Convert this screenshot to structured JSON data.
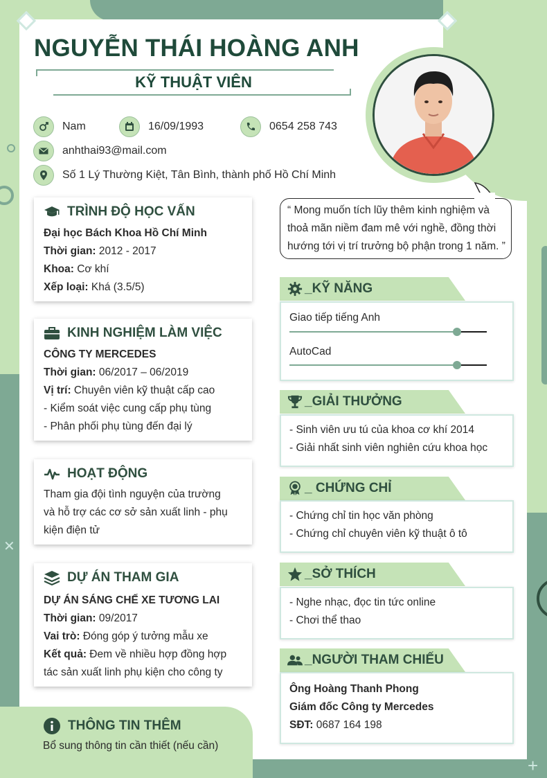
{
  "header": {
    "name": "NGUYỄN THÁI HOÀNG ANH",
    "job_title": "KỸ THUẬT VIÊN"
  },
  "contact": {
    "gender": "Nam",
    "birthday": "16/09/1993",
    "phone": "0654 258 743",
    "email": "anhthai93@mail.com",
    "address": "Số 1 Lý Thường Kiệt, Tân Bình, thành phố Hồ Chí Minh"
  },
  "quote": {
    "lines": [
      "“ Mong muốn tích lũy thêm kinh nghiệm và",
      "thoả mãn niềm đam mê với nghề, đồng thời",
      "hướng tới vị trí trưởng bộ phận trong 1 năm. ”"
    ]
  },
  "education": {
    "title": "TRÌNH ĐỘ HỌC VẤN",
    "school": "Đại học Bách Khoa Hồ Chí Minh",
    "time_label": "Thời gian:",
    "time_value": " 2012 - 2017",
    "faculty_label": "Khoa:",
    "faculty_value": " Cơ khí",
    "rank_label": "Xếp loại:",
    "rank_value": " Khá (3.5/5)"
  },
  "experience": {
    "title": "KINH NGHIỆM LÀM VIỆC",
    "company": "CÔNG TY MERCEDES",
    "time_label": "Thời gian:",
    "time_value": " 06/2017 – 06/2019",
    "position_label": "Vị trí:",
    "position_value": " Chuyên viên kỹ thuật cấp cao",
    "duties": [
      "- Kiểm soát việc cung cấp phụ tùng",
      "- Phân phối phụ tùng đến đại lý"
    ]
  },
  "activities": {
    "title": "HOẠT ĐỘNG",
    "lines": [
      "Tham gia đội tình nguyện của trường",
      "và hỗ trợ các cơ sở sản xuất linh - phụ",
      "kiện điện tử"
    ]
  },
  "projects": {
    "title": "DỰ ÁN THAM GIA",
    "name": "DỰ ÁN SÁNG CHẾ XE TƯƠNG LAI",
    "time_label": "Thời gian:",
    "time_value": " 09/2017",
    "role_label": "Vai trò:",
    "role_value": " Đóng góp ý tưởng mẫu xe",
    "result_label": "Kết quả:",
    "result_value": " Đem về nhiều hợp đồng hợp",
    "result_value_2": "tác sản xuất linh phụ kiện cho công ty"
  },
  "extra": {
    "title": "THÔNG TIN THÊM",
    "text": "Bổ sung thông tin cần thiết (nếu cần)"
  },
  "skills": {
    "title": "_KỸ NĂNG",
    "items": [
      {
        "label": "Giao tiếp tiếng Anh",
        "level": 0.85
      },
      {
        "label": "AutoCad",
        "level": 0.85
      }
    ]
  },
  "awards": {
    "title": "_GIẢI THƯỞNG",
    "items": [
      "- Sinh viên ưu tú của khoa cơ khí 2014",
      "- Giải nhất sinh viên nghiên cứu khoa học"
    ]
  },
  "certificates": {
    "title": "_ CHỨNG CHỈ",
    "items": [
      "- Chứng chỉ tin học văn phòng",
      "- Chứng chỉ chuyên viên kỹ thuật ô tô"
    ]
  },
  "hobbies": {
    "title": "_SỞ THÍCH",
    "items": [
      "- Nghe nhạc, đọc tin tức online",
      "- Chơi thể thao"
    ]
  },
  "references": {
    "title": "_NGƯỜI THAM CHIẾU",
    "person": "Ông Hoàng Thanh Phong",
    "role": "Giám đốc Công ty Mercedes",
    "phone_label": "SĐT:",
    "phone_value": " 0687 164 198"
  },
  "colors": {
    "dark_green": "#2f4f3f",
    "light_green": "#c5e3b7",
    "mid_green": "#7ea994"
  }
}
